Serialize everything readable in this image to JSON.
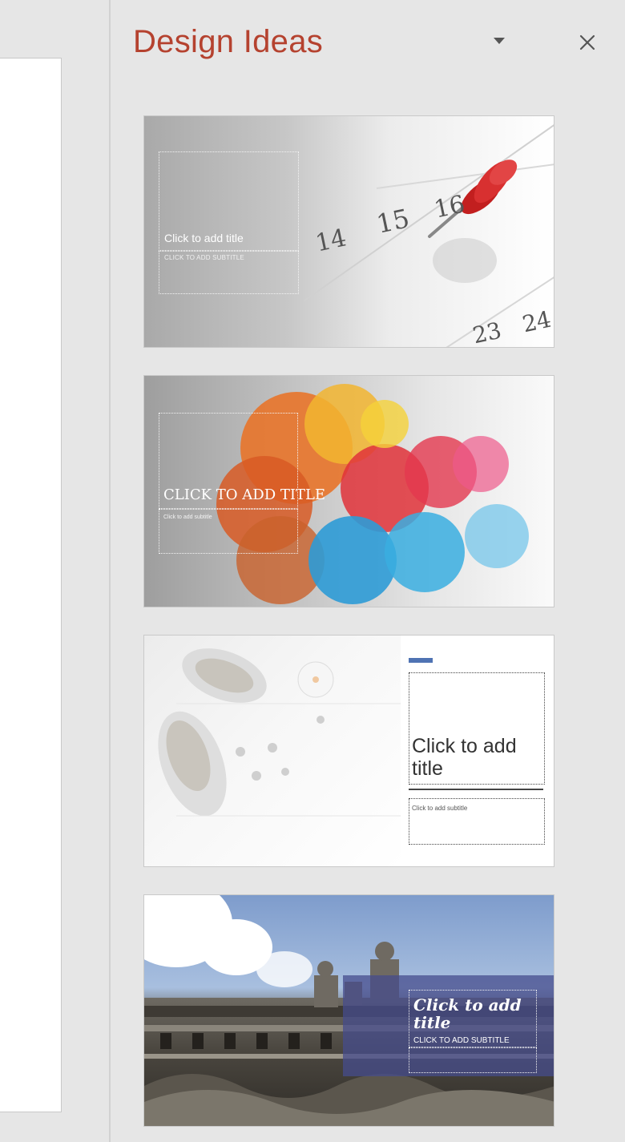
{
  "pane": {
    "title": "Design Ideas",
    "menu_icon": "dropdown-triangle-icon",
    "close_icon": "close-icon"
  },
  "designs": [
    {
      "title_placeholder": "Click to add title",
      "subtitle_placeholder": "CLICK TO ADD SUBTITLE",
      "calendar_numbers": [
        "14",
        "15",
        "16",
        "23",
        "24"
      ],
      "pin_color": "#d42a2a"
    },
    {
      "title_placeholder": "CLICK TO ADD TITLE",
      "subtitle_placeholder": "Click to add subtitle"
    },
    {
      "title_placeholder": "Click to add title",
      "subtitle_placeholder": "Click to add subtitle",
      "accent_color": "#4f73b3"
    },
    {
      "title_placeholder": "Click to add title",
      "subtitle_placeholder": "CLICK TO ADD SUBTITLE"
    }
  ],
  "colors": {
    "title_accent": "#b5422f",
    "pane_background": "#e6e6e6"
  }
}
